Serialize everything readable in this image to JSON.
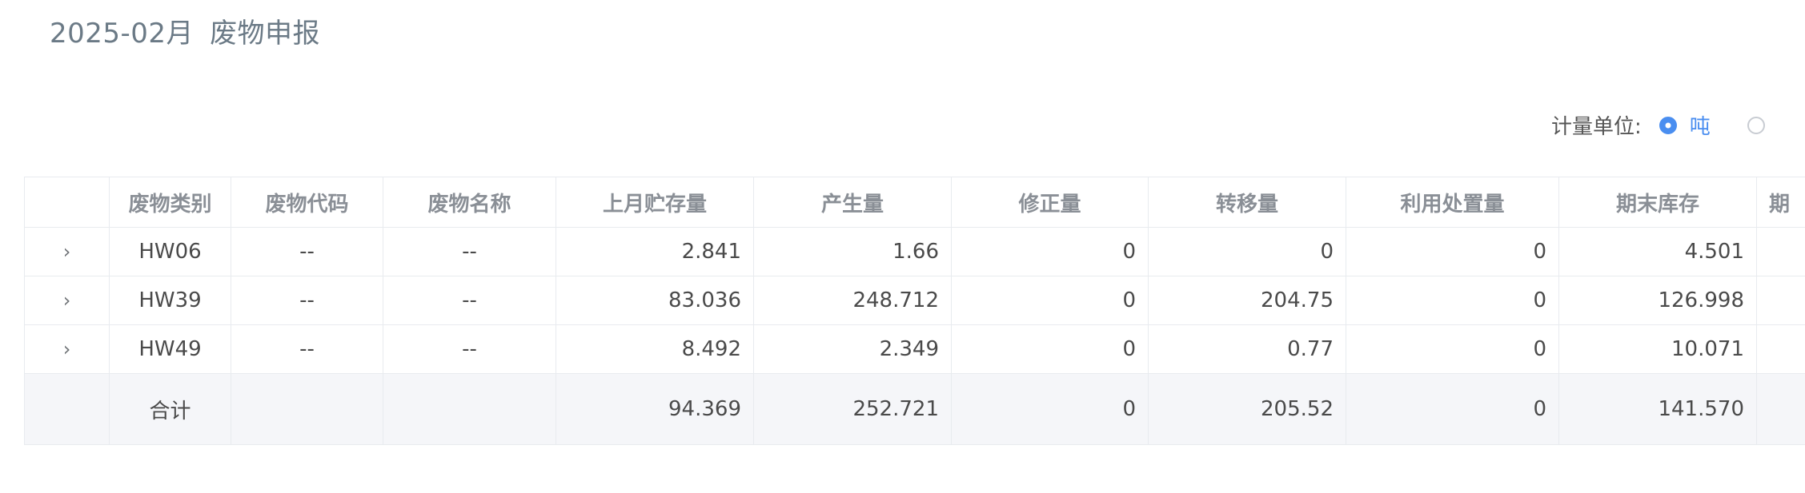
{
  "page": {
    "period": "2025-02月",
    "title": "废物申报"
  },
  "unit": {
    "label": "计量单位:",
    "options": [
      "吨",
      ""
    ],
    "selected": "吨"
  },
  "table": {
    "headers": [
      "",
      "废物类别",
      "废物代码",
      "废物名称",
      "上月贮存量",
      "产生量",
      "修正量",
      "转移量",
      "利用处置量",
      "期末库存",
      "期"
    ],
    "rows": [
      {
        "expand": "›",
        "category": "HW06",
        "code": "--",
        "name": "--",
        "last_month_stock": "2.841",
        "generated": "1.66",
        "corrected": "0",
        "transferred": "0",
        "utilized": "0",
        "ending_stock": "4.501",
        "extra": ""
      },
      {
        "expand": "›",
        "category": "HW39",
        "code": "--",
        "name": "--",
        "last_month_stock": "83.036",
        "generated": "248.712",
        "corrected": "0",
        "transferred": "204.75",
        "utilized": "0",
        "ending_stock": "126.998",
        "extra": ""
      },
      {
        "expand": "›",
        "category": "HW49",
        "code": "--",
        "name": "--",
        "last_month_stock": "8.492",
        "generated": "2.349",
        "corrected": "0",
        "transferred": "0.77",
        "utilized": "0",
        "ending_stock": "10.071",
        "extra": ""
      }
    ],
    "total": {
      "label": "合计",
      "last_month_stock": "94.369",
      "generated": "252.721",
      "corrected": "0",
      "transferred": "205.52",
      "utilized": "0",
      "ending_stock": "141.570",
      "extra": ""
    }
  }
}
